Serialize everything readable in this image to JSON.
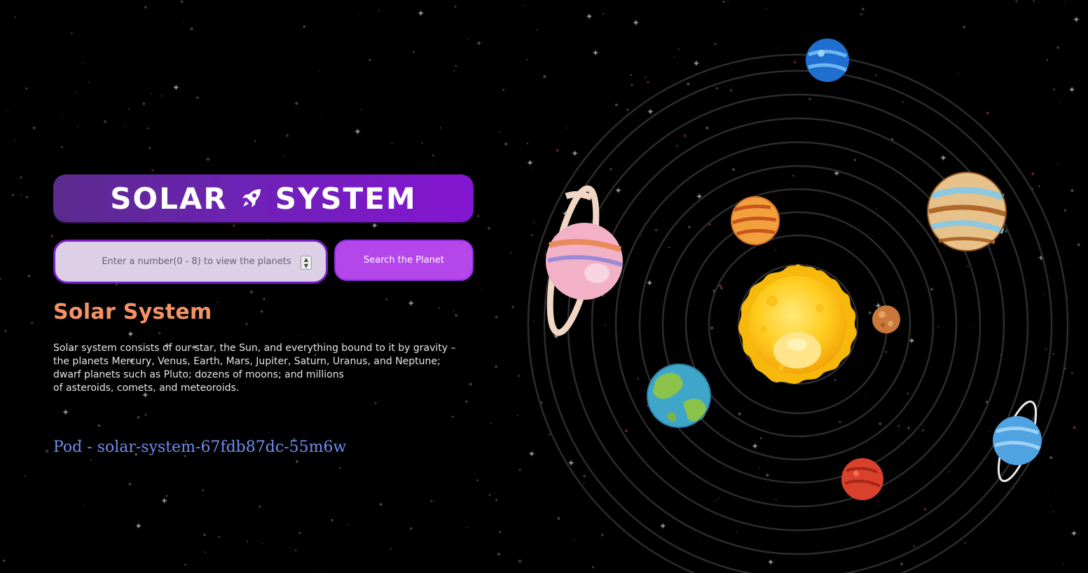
{
  "header": {
    "title_left": "SOLAR",
    "title_right": "SYSTEM",
    "title_icon": "rocket-icon"
  },
  "search": {
    "placeholder": "Enter a number(0 - 8) to view the planets",
    "value": "",
    "button_label": "Search the Planet"
  },
  "planet": {
    "name": "Solar System",
    "description_lines": [
      "Solar system consists of our star, the Sun, and everything bound to it by gravity –",
      "the planets Mercury, Venus, Earth, Mars, Jupiter, Saturn, Uranus, and Neptune;",
      "dwarf planets such as Pluto; dozens of moons; and millions",
      "of asteroids, comets, and meteoroids."
    ]
  },
  "pod": {
    "label": "Pod - solar-system-67fdb87dc-55m6w"
  },
  "colors": {
    "background": "#000000",
    "title_gradient_start": "#5a2a8c",
    "title_gradient_end": "#8415d1",
    "button": "#b446ea",
    "heading": "#f59365",
    "pod": "#6f8ff0"
  }
}
